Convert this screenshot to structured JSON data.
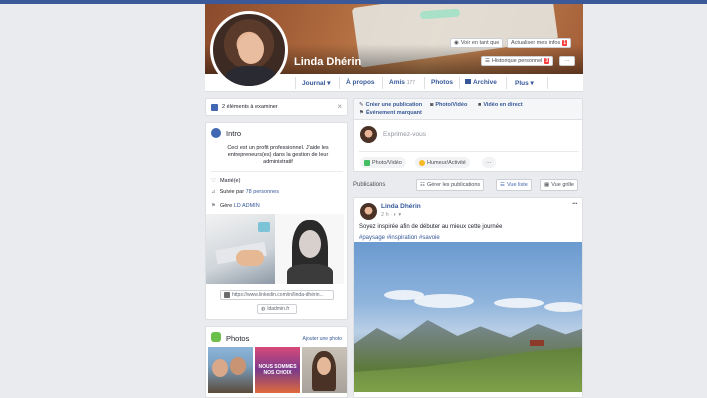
{
  "profile": {
    "name": "Linda Dhérin",
    "view_as_label": "Voir en tant que",
    "update_info_label": "Actualiser mes infos",
    "update_info_badge": "1",
    "history_label": "Historique personnel",
    "history_badge": "3",
    "more_dots": "···"
  },
  "tabs": [
    {
      "label": "Journal ▾"
    },
    {
      "label": "À propos"
    },
    {
      "label": "Amis",
      "count": "177"
    },
    {
      "label": "Photos"
    },
    {
      "label": "Archive"
    },
    {
      "label": "Plus ▾"
    }
  ],
  "review": {
    "text": "2 éléments à examiner",
    "close": "×"
  },
  "intro": {
    "title": "Intro",
    "bio": "Ceci est un profit professionnel. J'aide les entrepreneurs(es) dans la gestion de leur administratif",
    "status": "Marié(e)",
    "followed_prefix": "Suivie par ",
    "followed_link": "78 personnes",
    "manages_prefix": "Gère ",
    "manages_link": "LD ADMIN",
    "linkedin_url": "https://www.linkedin.com/in/linda-dhérin...",
    "website": "ldadmin.fr"
  },
  "photos": {
    "title": "Photos",
    "add_label": "Ajouter une photo",
    "overlay_text": "NOUS SOMMES NOS CHOIX"
  },
  "composer": {
    "create_post": "Créer une publication",
    "photo_video": "Photo/Vidéo",
    "live_video": "Vidéo en direct",
    "life_event": "Événement marquant",
    "placeholder": "Exprimez-vous",
    "btn_photo": "Photo/Vidéo",
    "btn_mood": "Humeur/Activité",
    "btn_more": "···"
  },
  "publications": {
    "label": "Publications",
    "manage_label": "Gérer les publications",
    "list_view": "Vue liste",
    "grid_view": "Vue grille"
  },
  "post": {
    "author": "Linda Dhérin",
    "time": "2 h",
    "privacy": "· ◐ ▾",
    "text": "Soyez inspirée afin de débuter au mieux cette journée",
    "hashtags": "#paysage #inspiration #savoie",
    "more_dots": "···"
  },
  "colors": {
    "brand": "#3b5998",
    "link": "#365899",
    "badge": "#fa3e3e",
    "bg": "#e9ebee"
  }
}
